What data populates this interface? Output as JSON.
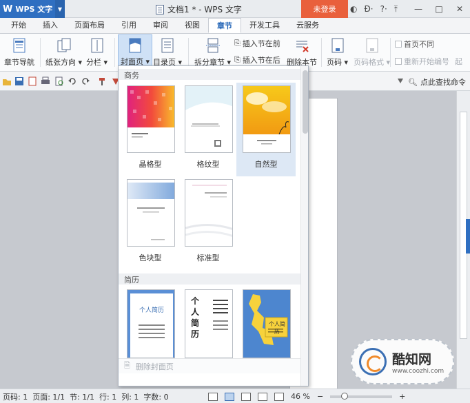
{
  "titlebar": {
    "app_name": "WPS 文字",
    "doc_title": "文档1 * - WPS 文字",
    "login_label": "未登录"
  },
  "tabs": [
    {
      "label": "开始"
    },
    {
      "label": "插入"
    },
    {
      "label": "页面布局"
    },
    {
      "label": "引用"
    },
    {
      "label": "审阅"
    },
    {
      "label": "视图"
    },
    {
      "label": "章节",
      "active": true
    },
    {
      "label": "开发工具"
    },
    {
      "label": "云服务"
    }
  ],
  "ribbon": {
    "chapter_nav": "章节导航",
    "paper_orientation": "纸张方向",
    "columns": "分栏",
    "cover_page": "封面页",
    "toc_page": "目录页",
    "split_chapter": "拆分章节",
    "insert_before": "插入节在前",
    "insert_after": "插入节在后",
    "delete_section": "删除本节",
    "page_number": "页码",
    "page_number_format": "页码格式",
    "first_page_different": "首页不同",
    "restart_numbering": "重新开始编号",
    "extra": "起"
  },
  "quickbar": {
    "find_command": "点此查找命令"
  },
  "cover_panel": {
    "sections": [
      {
        "title": "商务",
        "items": [
          {
            "label": "晶格型"
          },
          {
            "label": "格纹型"
          },
          {
            "label": "自然型",
            "hover": true
          },
          {
            "label": "色块型"
          },
          {
            "label": "标准型"
          }
        ]
      },
      {
        "title": "简历",
        "items": [
          {
            "thumb_text": "个人简历"
          },
          {
            "thumb_text": "个 人 简 历"
          },
          {
            "thumb_text": "个人简历"
          }
        ]
      }
    ],
    "delete_label": "删除封面页"
  },
  "statusbar": {
    "page_no": "页码: 1",
    "pages": "页面: 1/1",
    "section": "节: 1/1",
    "row": "行: 1",
    "col": "列: 1",
    "words": "字数: 0",
    "zoom": "46 %",
    "zoom_fraction": 0.2
  },
  "watermark": {
    "name": "酷知网",
    "url": "www.coozhi.com"
  },
  "colors": {
    "accent": "#2f6fc1",
    "login": "#e9603c",
    "hover": "#dde8f5"
  }
}
